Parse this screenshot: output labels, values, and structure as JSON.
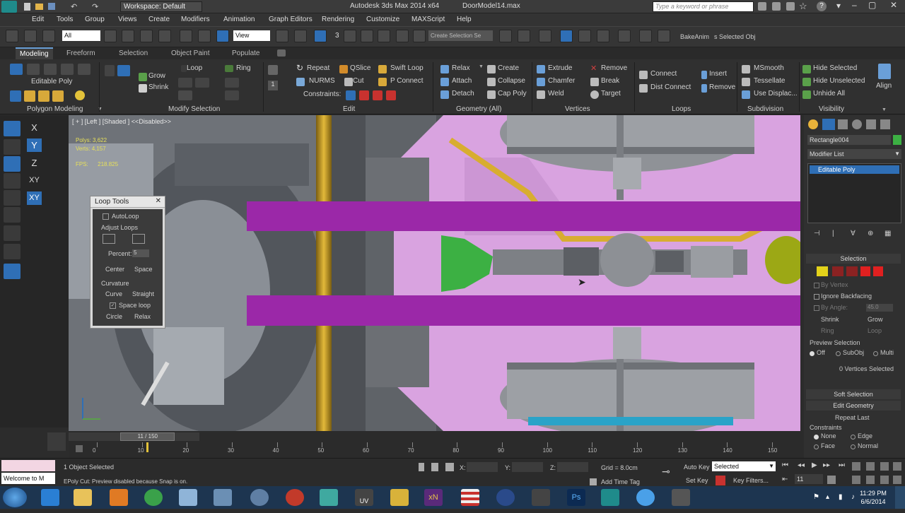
{
  "titlebar": {
    "workspace_label": "Workspace: Default",
    "app_title": "Autodesk 3ds Max  2014 x64",
    "file_title": "DoorModel14.max",
    "search_placeholder": "Type a keyword or phrase"
  },
  "menu": [
    "Edit",
    "Tools",
    "Group",
    "Views",
    "Create",
    "Modifiers",
    "Animation",
    "Graph Editors",
    "Rendering",
    "Customize",
    "MAXScript",
    "Help"
  ],
  "toolbar": {
    "filter_value": "All",
    "refcoord_value": "View",
    "selection_set_placeholder": "Create Selection Se",
    "bake_anim_label": "BakeAnim",
    "selected_obj_label": "s Selected Obj",
    "snap_value": "3"
  },
  "ribbon_tabs": [
    "Modeling",
    "Freeform",
    "Selection",
    "Object Paint",
    "Populate"
  ],
  "ribbon": {
    "polygon_modeling": {
      "object_label": "Editable Poly",
      "group": "Polygon Modeling"
    },
    "modify_selection": {
      "grow": "Grow",
      "shrink": "Shrink",
      "loop": "Loop",
      "ring": "Ring",
      "group": "Modify Selection"
    },
    "edit": {
      "repeat": "Repeat",
      "qslice": "QSlice",
      "swift_loop": "Swift Loop",
      "nurms": "NURMS",
      "cut": "Cut",
      "p_connect": "P Connect",
      "constraints": "Constraints:",
      "group": "Edit"
    },
    "geometry": {
      "relax": "Relax",
      "create": "Create",
      "attach": "Attach",
      "collapse": "Collapse",
      "detach": "Detach",
      "cap_poly": "Cap Poly",
      "group": "Geometry (All)"
    },
    "vertices": {
      "extrude": "Extrude",
      "remove": "Remove",
      "chamfer": "Chamfer",
      "break": "Break",
      "weld": "Weld",
      "target": "Target",
      "group": "Vertices"
    },
    "loops": {
      "connect": "Connect",
      "insert": "Insert",
      "dist_connect": "Dist Connect",
      "remove": "Remove",
      "group": "Loops"
    },
    "subdivision": {
      "msmooth": "MSmooth",
      "tessellate": "Tessellate",
      "use_displac": "Use Displac...",
      "group": "Subdivision"
    },
    "visibility": {
      "hide_selected": "Hide Selected",
      "hide_unselected": "Hide Unselected",
      "unhide_all": "Unhide All",
      "group": "Visibility"
    },
    "align": {
      "label": "Align"
    }
  },
  "axis_constraints": [
    "X",
    "Y",
    "Z",
    "XY",
    "XY"
  ],
  "viewport": {
    "label": "[ + ] [Left ] [Shaded ]  <<Disabled>>",
    "stats": {
      "label1": "Polys:",
      "value1": "3,622",
      "label2": "Verts:",
      "value2": "4,157",
      "fps_label": "FPS:",
      "fps_value": "218.825"
    }
  },
  "loop_tools": {
    "title": "Loop Tools",
    "autoloop": "AutoLoop",
    "adjust_loops": "Adjust Loops",
    "percent_label": "Percent:",
    "percent_value": "5",
    "center": "Center",
    "space": "Space",
    "curvature": "Curvature",
    "curve": "Curve",
    "straight": "Straight",
    "space_loop": "Space loop",
    "circle": "Circle",
    "relax": "Relax"
  },
  "command_panel": {
    "object_name": "Rectangle004",
    "modifier_list": "Modifier List",
    "stack_item": "Editable Poly",
    "selection_header": "Selection",
    "by_vertex": "By Vertex",
    "ignore_backfacing": "Ignore Backfacing",
    "by_angle": "By Angle:",
    "by_angle_value": "45.0",
    "shrink": "Shrink",
    "grow": "Grow",
    "ring": "Ring",
    "loop": "Loop",
    "preview_selection": "Preview Selection",
    "preview_off": "Off",
    "preview_subobj": "SubObj",
    "preview_multi": "Multi",
    "vertices_selected": "0 Vertices Selected",
    "soft_selection": "Soft Selection",
    "edit_geometry": "Edit Geometry",
    "repeat_last": "Repeat Last",
    "constraints": "Constraints",
    "c_none": "None",
    "c_edge": "Edge",
    "c_face": "Face",
    "c_normal": "Normal"
  },
  "timeline": {
    "frame_counter": "11 / 150",
    "ticks": [
      "0",
      "10",
      "20",
      "30",
      "40",
      "50",
      "60",
      "70",
      "80",
      "90",
      "100",
      "110",
      "120",
      "130",
      "140",
      "150"
    ],
    "current_frame": 11,
    "total_frames": 150
  },
  "status": {
    "welcome": "Welcome to M",
    "selection": "1 Object Selected",
    "prompt": "EPoly Cut: Preview disabled because Snap is on.",
    "x_label": "X:",
    "y_label": "Y:",
    "z_label": "Z:",
    "grid": "Grid = 8.0cm",
    "auto_key": "Auto Key",
    "selected_value": "Selected",
    "set_key": "Set Key",
    "key_filters": "Key Filters...",
    "add_time_tag": "Add Time Tag",
    "frame_value": "11"
  },
  "taskbar": {
    "time": "11:29 PM",
    "date": "6/6/2014",
    "apps": [
      "windows-start",
      "internet-explorer",
      "file-explorer",
      "media-player",
      "chrome",
      "notepad",
      "window",
      "network",
      "firefox-like",
      "3dsmax-app",
      "unfold3d",
      "sketch",
      "xnormal",
      "stripes",
      "unreal",
      "coffeecup",
      "photoshop",
      "max-logo",
      "itunes-like",
      "misc-app"
    ]
  },
  "colors": {
    "accent": "#2f6fb6",
    "viewport_pink": "#d9a3e0",
    "magenta_band": "#9b28a8",
    "green_shape": "#3cb043",
    "gold_pipe": "#c9a227"
  }
}
